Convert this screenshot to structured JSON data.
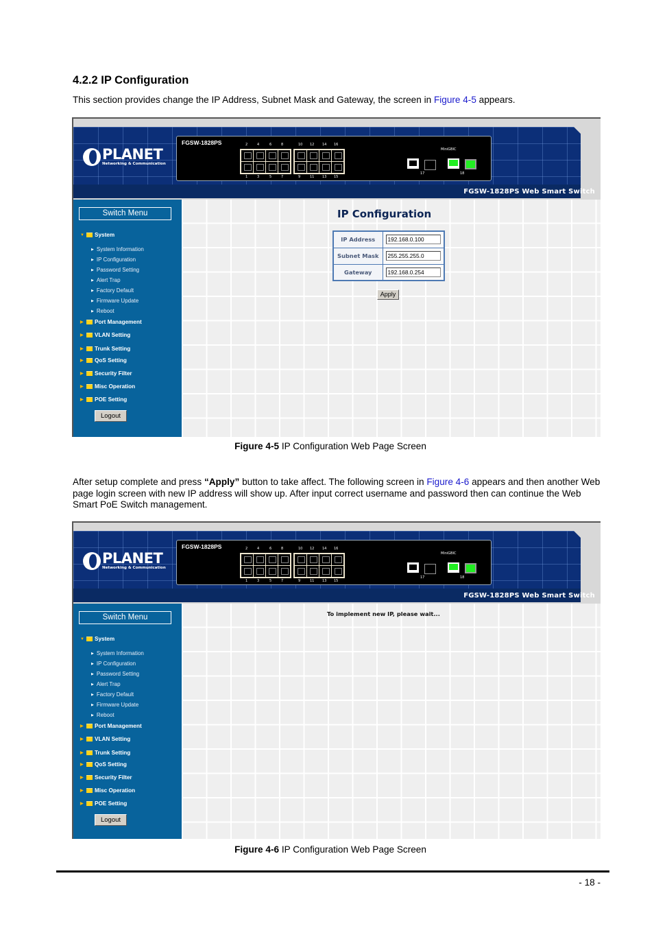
{
  "section": {
    "heading": "4.2.2 IP Configuration",
    "intro_before": "This section provides change the IP Address, Subnet Mask and Gateway, the screen in ",
    "intro_link": "Figure 4-5",
    "intro_after": " appears."
  },
  "after_text": {
    "part1": "After setup complete and press ",
    "bold": "“Apply”",
    "part2": " button to take affect. The following screen in ",
    "link": "Figure 4-6",
    "part3": " appears and then another Web page login screen with new IP address will show up. After input correct username and password then can continue the Web Smart PoE Switch management."
  },
  "figures": [
    {
      "label": "Figure 4-5",
      "caption": " IP Configuration Web Page Screen"
    },
    {
      "label": "Figure 4-6",
      "caption": " IP Configuration Web Page Screen"
    }
  ],
  "device": {
    "logo": "PLANET",
    "logo_sub": "Networking & Communication",
    "model": "FGSW-1828PS",
    "banner_title": "FGSW-1828PS Web Smart Switch",
    "ports_top": [
      "2",
      "4",
      "6",
      "8",
      "10",
      "12",
      "14",
      "16"
    ],
    "ports_bottom": [
      "1",
      "3",
      "5",
      "7",
      "9",
      "11",
      "13",
      "15"
    ],
    "minigbic_label": "MiniGBIC",
    "port17": "17",
    "port18": "18",
    "link_color": "#22ee22"
  },
  "sidebar": {
    "title": "Switch Menu",
    "system_label": "System",
    "system_items": [
      "System Information",
      "IP Configuration",
      "Password Setting",
      "Alert Trap",
      "Factory Default",
      "Firmware Update",
      "Reboot"
    ],
    "groups": [
      "Port Management",
      "VLAN Setting",
      "Trunk Setting",
      "QoS Setting",
      "Security Filter",
      "Misc Operation",
      "POE Setting"
    ],
    "logout": "Logout"
  },
  "ip_config": {
    "title": "IP Configuration",
    "fields": [
      {
        "label": "IP Address",
        "value": "192.168.0.100"
      },
      {
        "label": "Subnet Mask",
        "value": "255.255.255.0"
      },
      {
        "label": "Gateway",
        "value": "192.168.0.254"
      }
    ],
    "apply": "Apply"
  },
  "wait_message": "To implement new IP, please wait...",
  "page_number": "- 18 -"
}
